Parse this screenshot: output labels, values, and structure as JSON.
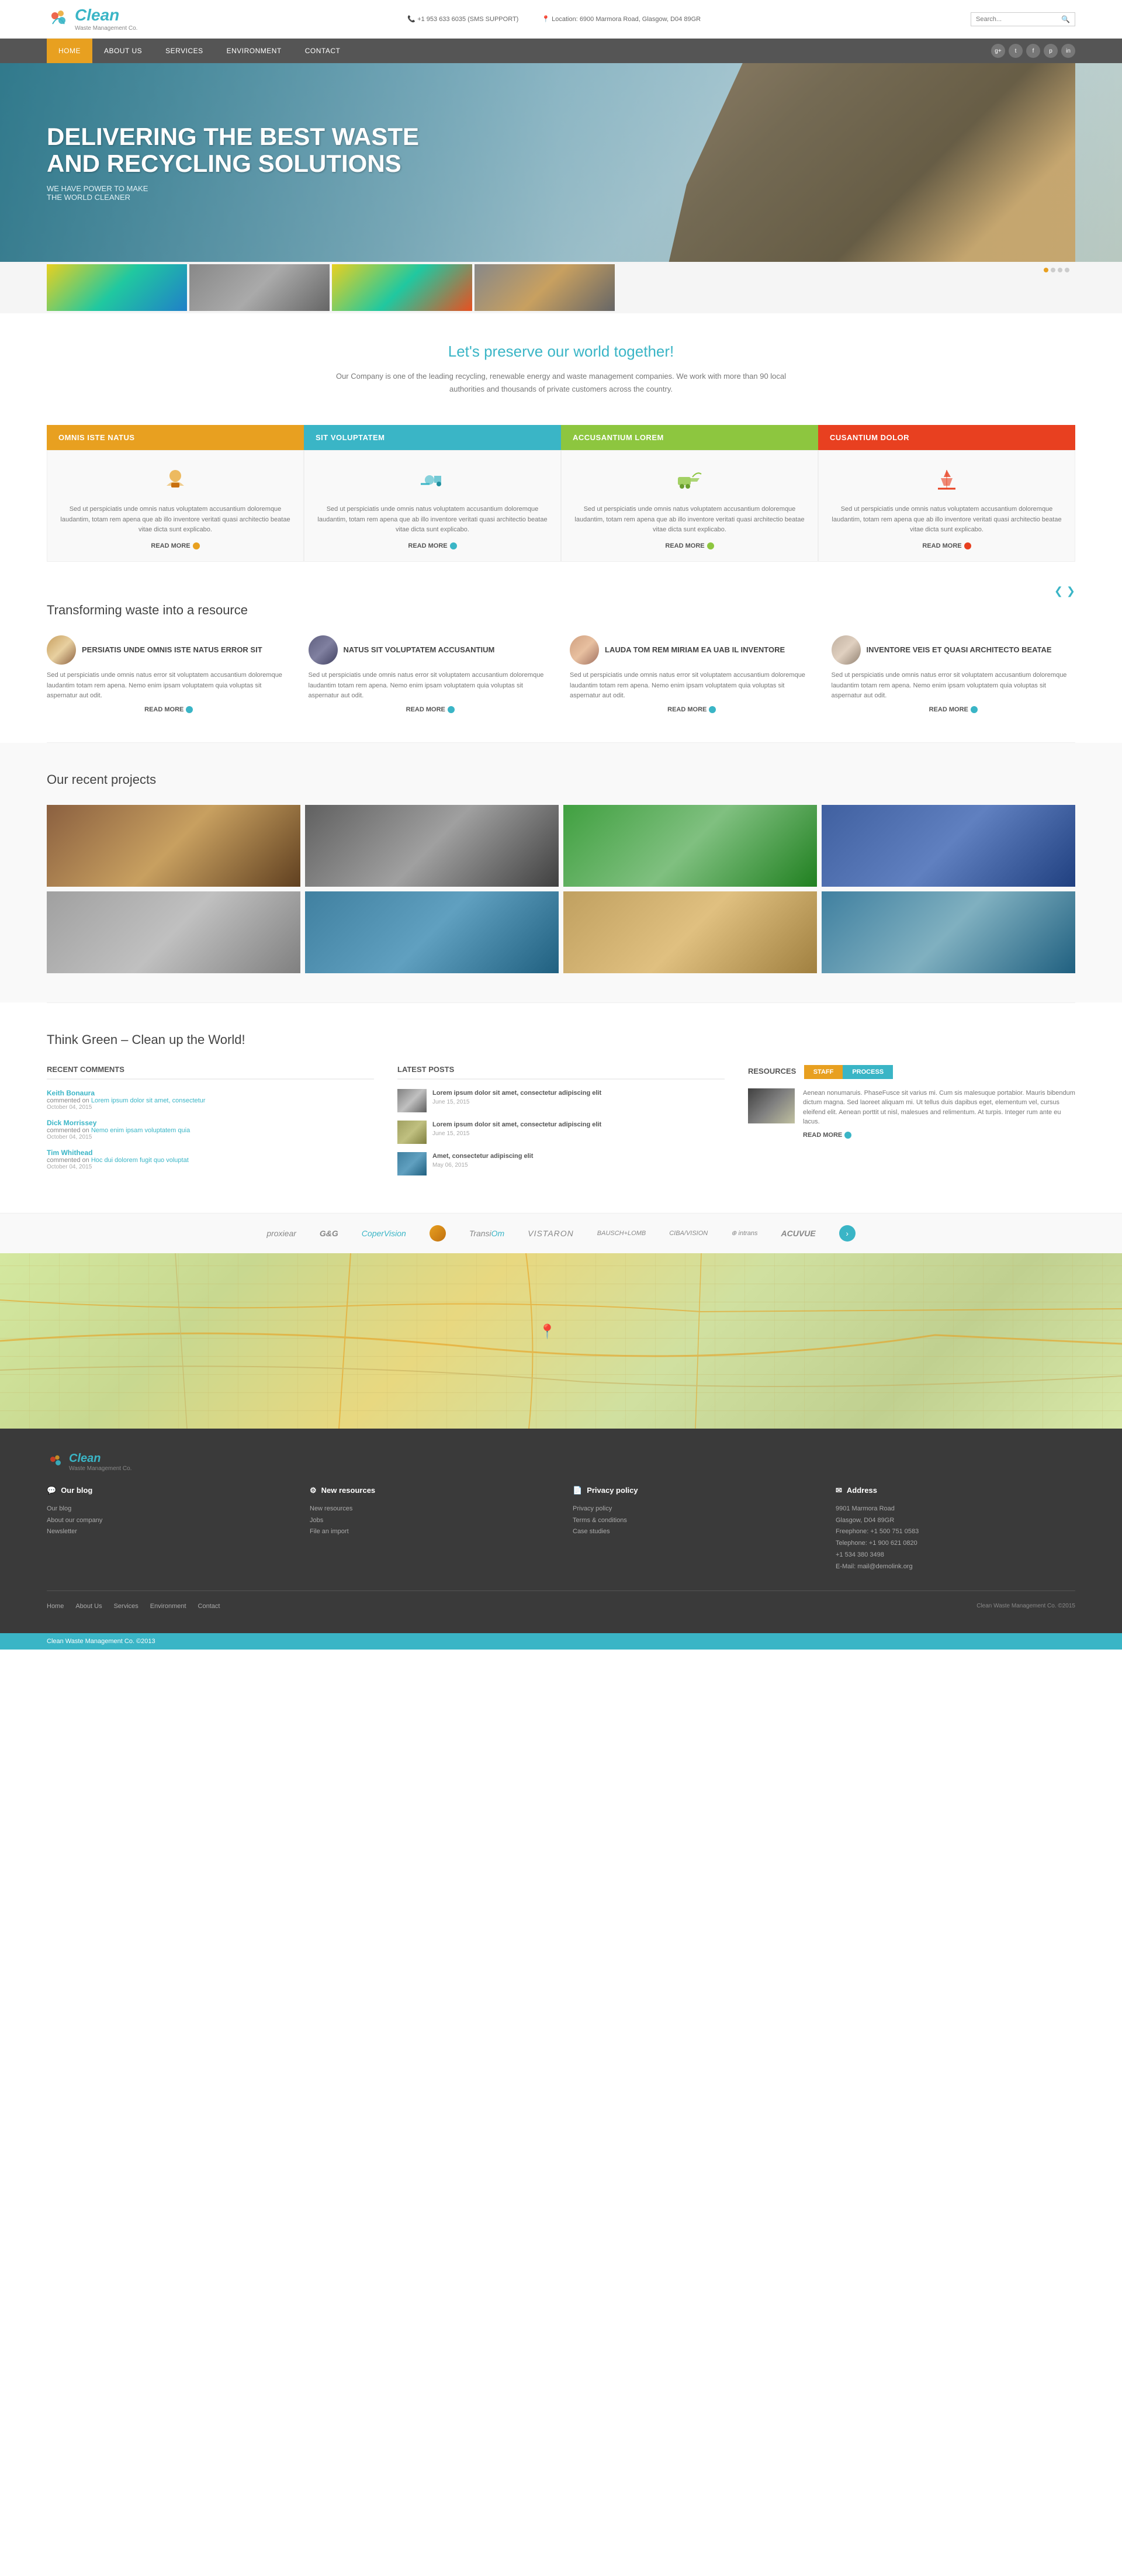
{
  "site": {
    "name": "Clean",
    "tagline": "Waste Management Co.",
    "phone": "+1 953 633 6035 (SMS SUPPORT)",
    "location_label": "Location:",
    "address": "6900 Marmora Road, Glasgow, D04 89GR",
    "search_placeholder": "Search..."
  },
  "nav": {
    "items": [
      {
        "label": "HOME",
        "active": true
      },
      {
        "label": "ABOUT US",
        "active": false
      },
      {
        "label": "SERVICES",
        "active": false
      },
      {
        "label": "ENVIRONMENT",
        "active": false
      },
      {
        "label": "CONTACT",
        "active": false
      }
    ]
  },
  "hero": {
    "title_line1": "DELIVERING THE BEST WASTE",
    "title_line2": "AND RECYCLING SOLUTIONS",
    "subtitle_line1": "WE HAVE POWER TO MAKE",
    "subtitle_line2": "THE WORLD CLEANER"
  },
  "intro": {
    "heading": "Let's preserve our world together!",
    "body": "Our Company is one of the leading recycling, renewable energy and waste management companies. We work with more than 90 local authorities and thousands of private customers across the country."
  },
  "services": [
    {
      "title": "OMNIS ISTE NATUS",
      "color_class": "sb-yellow",
      "dot_class": "dot-yellow",
      "body": "Sed ut perspiciatis unde omnis natus voluptatem accusantium doloremque laudantim, totam rem apena que ab illo inventore veritati quasi architectio beatae vitae dicta sunt explicabo.",
      "read_more": "READ MORE"
    },
    {
      "title": "SIT VOLUPTATEM",
      "color_class": "sb-teal",
      "dot_class": "dot-teal",
      "body": "Sed ut perspiciatis unde omnis natus voluptatem accusantium doloremque laudantim, totam rem apena que ab illo inventore veritati quasi architectio beatae vitae dicta sunt explicabo.",
      "read_more": "READ MORE"
    },
    {
      "title": "ACCUSANTIUM LOREM",
      "color_class": "sb-green",
      "dot_class": "dot-green",
      "body": "Sed ut perspiciatis unde omnis natus voluptatem accusantium doloremque laudantim, totam rem apena que ab illo inventore veritati quasi architectio beatae vitae dicta sunt explicabo.",
      "read_more": "READ MORE"
    },
    {
      "title": "CUSANTIUM DOLOR",
      "color_class": "sb-red",
      "dot_class": "dot-red",
      "body": "Sed ut perspiciatis unde omnis natus voluptatem accusantium doloremque laudantim, totam rem apena que ab illo inventore veritati quasi architectio beatae vitae dicta sunt explicabo.",
      "read_more": "READ MORE"
    }
  ],
  "transform": {
    "heading": "Transforming waste into a resource",
    "team": [
      {
        "name": "PERSIATIS UNDE OMNIS ISTE NATUS ERROR SIT",
        "avatar_class": "avatar-1",
        "body": "Sed ut perspiciatis unde omnis natus error sit voluptatem accusantium doloremque laudantim totam rem apena. Nemo enim ipsam voluptatem quia voluptas sit aspernatur aut odit.",
        "read_more": "READ MORE"
      },
      {
        "name": "NATUS SIT VOLUPTATEM ACCUSANTIUM",
        "avatar_class": "avatar-2",
        "body": "Sed ut perspiciatis unde omnis natus error sit voluptatem accusantium doloremque laudantim totam rem apena. Nemo enim ipsam voluptatem quia voluptas sit aspernatur aut odit.",
        "read_more": "READ MORE"
      },
      {
        "name": "LAUDA TOM REM MIRIAM EA UAB IL INVENTORE",
        "avatar_class": "avatar-3",
        "body": "Sed ut perspiciatis unde omnis natus error sit voluptatem accusantium doloremque laudantim totam rem apena. Nemo enim ipsam voluptatem quia voluptas sit aspernatur aut odit.",
        "read_more": "READ MORE"
      },
      {
        "name": "INVENTORE VEIS ET QUASI ARCHITECTO BEATAE",
        "avatar_class": "avatar-4",
        "body": "Sed ut perspiciatis unde omnis natus error sit voluptatem accusantium doloremque laudantim totam rem apena. Nemo enim ipsam voluptatem quia voluptas sit aspernatur aut odit.",
        "read_more": "READ MORE"
      }
    ]
  },
  "projects": {
    "heading": "Our recent projects",
    "items": [
      {
        "class": "proj-1"
      },
      {
        "class": "proj-2"
      },
      {
        "class": "proj-3"
      },
      {
        "class": "proj-4"
      },
      {
        "class": "proj-5"
      },
      {
        "class": "proj-6"
      },
      {
        "class": "proj-7"
      },
      {
        "class": "proj-8"
      }
    ]
  },
  "think_green": {
    "heading": "Think Green – Clean up the World!"
  },
  "recent_comments": {
    "heading": "RECENT COMMENTS",
    "items": [
      {
        "author": "Keith Bonaura",
        "action": "commented on",
        "link": "Lorem ipsum dolor sit amet, consectetur",
        "text": "",
        "date": "October 04, 2015"
      },
      {
        "author": "Dick Morrissey",
        "action": "commented on",
        "link": "Nemo enim ipsam voluptatem quia",
        "text": "",
        "date": "October 04, 2015"
      },
      {
        "author": "Tim Whithead",
        "action": "commented on",
        "link": "Hoc dui dolorem fugit quo voluptat",
        "text": "",
        "date": "October 04, 2015"
      }
    ]
  },
  "latest_posts": {
    "heading": "LATEST POSTS",
    "items": [
      {
        "thumb_class": "post-thumb-1",
        "title": "Lorem ipsum dolor sit amet, consectetur adipiscing elit",
        "date": "June 15, 2015"
      },
      {
        "thumb_class": "post-thumb-2",
        "title": "Lorem ipsum dolor sit amet, consectetur adipiscing elit",
        "date": "June 15, 2015"
      },
      {
        "thumb_class": "post-thumb-3",
        "title": "Amet, consectetur adipiscing elit",
        "date": "May 06, 2015"
      }
    ]
  },
  "resources": {
    "heading": "RESOURCES",
    "tab_staff": "STAFF",
    "tab_process": "PROCESS",
    "body": "Aenean nonumaruis. PhaseFusce sit varius mi. Cum sis malesuque portabior. Mauris bibendum dictum magna. Sed laoreet aliquam mi. Ut tellus duis dapibus eget, elementum vel, cursus eleifend elit. Aenean porttit ut nisl, malesues and relimentum. At turpis. Integer rum ante eu lacus.",
    "read_more": "READ MORE"
  },
  "partners": [
    {
      "label": "proxiear",
      "style": "normal"
    },
    {
      "label": "G&G",
      "style": "normal"
    },
    {
      "label": "CoperVision",
      "style": "blue"
    },
    {
      "label": "⬤",
      "style": "circle-orange"
    },
    {
      "label": "TransiOm",
      "style": "normal"
    },
    {
      "label": "VISTARON",
      "style": "normal"
    },
    {
      "label": "BAUSCH+LOMB",
      "style": "normal"
    },
    {
      "label": "CIBA/VISION",
      "style": "normal"
    },
    {
      "label": "⊕ intrans",
      "style": "normal"
    },
    {
      "label": "ACUVUE",
      "style": "normal"
    }
  ],
  "footer": {
    "logo": "Clean",
    "logo_sub": "Waste Management Co.",
    "sections": [
      {
        "icon": "💬",
        "title": "Our blog",
        "links": [
          "Our blog",
          "About our company",
          "Newsletter"
        ]
      },
      {
        "icon": "⚙",
        "title": "New resources",
        "links": [
          "New resources",
          "Jobs",
          "File an import"
        ]
      },
      {
        "icon": "📄",
        "title": "Privacy policy",
        "links": [
          "Privacy policy",
          "Terms & conditions",
          "Case studies"
        ]
      },
      {
        "icon": "✉",
        "title": "Address",
        "address_lines": [
          "9901 Marmora Road",
          "Glasgow, D04 89GR",
          "Freephone: +1 500 751 0583",
          "Telephone: +1 900 621 0820",
          "+1 534 380 3498",
          "",
          "E-Mail: mail@demolink.org"
        ]
      }
    ],
    "bottom_links": [
      "Home",
      "About Us",
      "Services",
      "Environment",
      "Contact"
    ],
    "copyright": "Clean Waste Management Co. ©2015"
  },
  "green_bar": {
    "text": "Clean Waste Management Co. ©2013"
  }
}
